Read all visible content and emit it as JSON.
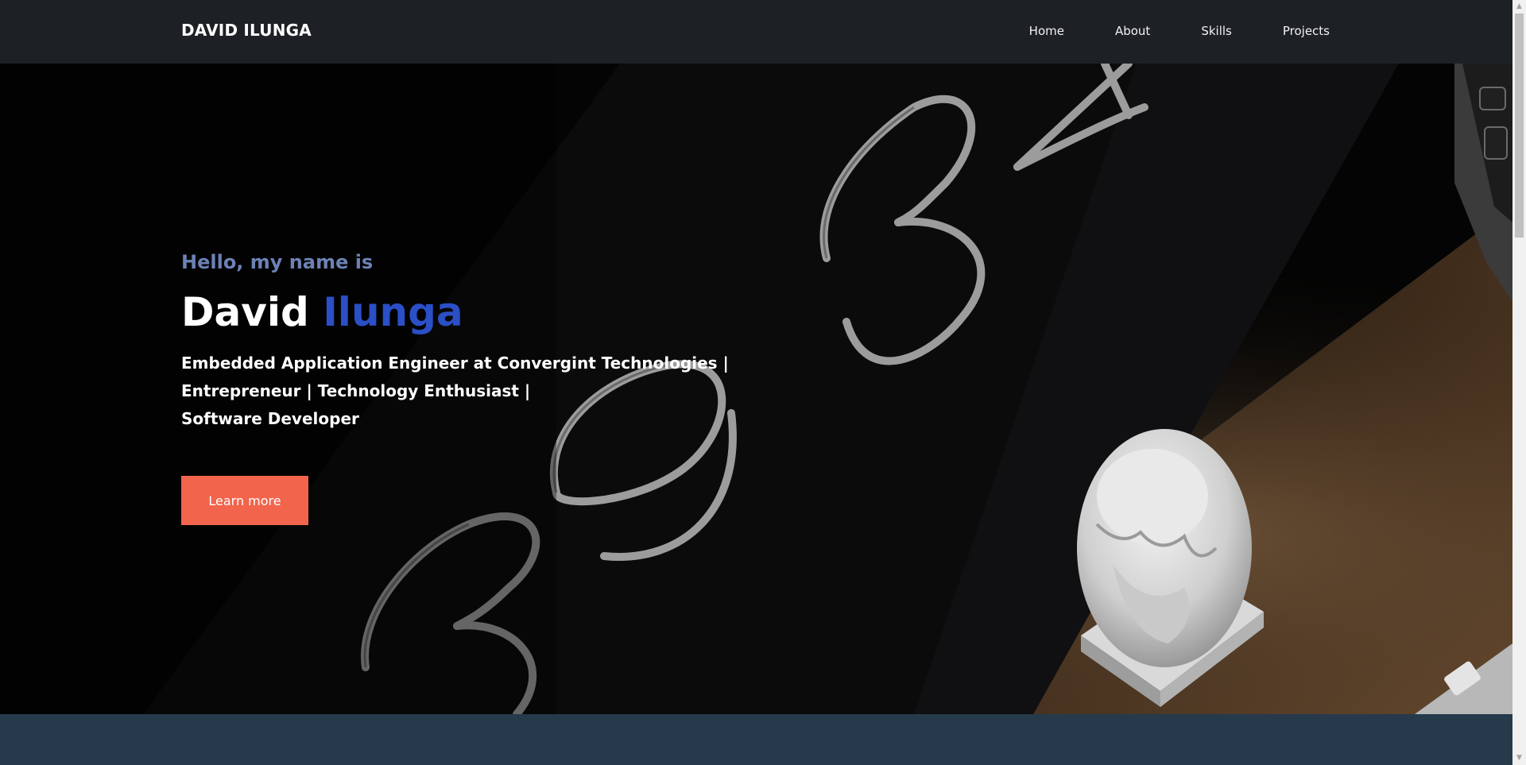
{
  "nav": {
    "brand": "DAVID ILUNGA",
    "links": [
      "Home",
      "About",
      "Skills",
      "Projects"
    ]
  },
  "hero": {
    "greeting": "Hello, my name is",
    "first_name": "David",
    "last_name": "Ilunga",
    "tagline_lines": [
      "Embedded Application Engineer at Convergint Technologies |",
      "Entrepreneur | Technology Enthusiast |",
      "Software Developer"
    ],
    "cta_label": "Learn more",
    "background_image": "dark-desk-with-handwritten-numbers-and-bust-statue"
  },
  "scrollbar": {
    "up_icon": "triangle-up-icon",
    "down_icon": "triangle-down-icon"
  },
  "colors": {
    "nav_bg": "#1d2125",
    "greeting": "#6c82b5",
    "last_name_accent": "#2a4fc6",
    "cta_bg": "#f2644c",
    "section_bg": "#263a4b"
  }
}
